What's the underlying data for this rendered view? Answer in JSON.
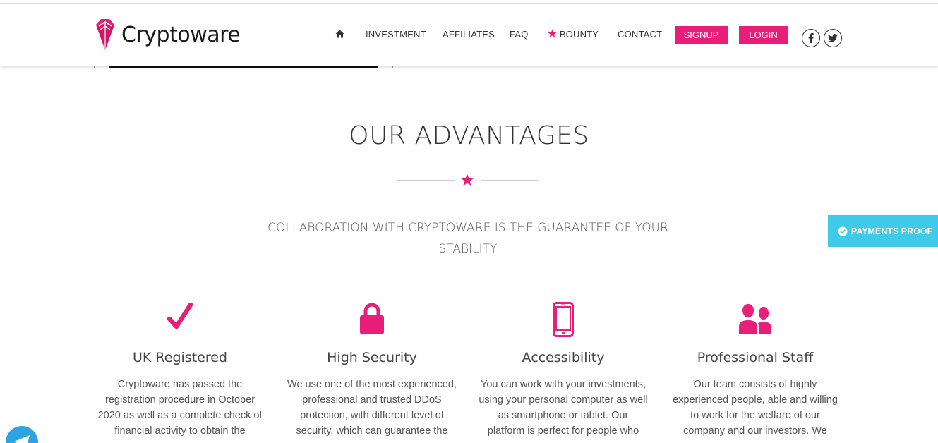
{
  "brand": {
    "name": "Cryptoware"
  },
  "nav": {
    "home_icon": "home-icon",
    "items": [
      {
        "label": "INVESTMENT"
      },
      {
        "label": "AFFILIATES"
      },
      {
        "label": "FAQ"
      },
      {
        "label": "BOUNTY",
        "icon": "star-icon"
      },
      {
        "label": "CONTACT"
      }
    ],
    "signup_label": "SIGNUP",
    "login_label": "LOGIN",
    "social_icons": [
      "facebook-icon",
      "twitter-icon"
    ]
  },
  "advantages": {
    "title": "OUR ADVANTAGES",
    "subtitle_line1": "COLLABORATION WITH CRYPTOWARE IS THE GUARANTEE OF YOUR",
    "subtitle_line2": "STABILITY",
    "features": [
      {
        "icon": "checkmark-icon",
        "title": "UK Registered",
        "desc_lines": [
          "Cryptoware has passed the",
          "registration procedure in October",
          "2020 as well as a complete check of",
          "financial activity to obtain the"
        ]
      },
      {
        "icon": "lock-icon",
        "title": "High Security",
        "desc_lines": [
          "We use one of the most experienced,",
          "professional and trusted DDoS",
          "protection, with different level of",
          "security, which can guarantee the"
        ]
      },
      {
        "icon": "smartphone-icon",
        "title": "Accessibility",
        "desc_lines": [
          "You can work with your investments,",
          "using your personal computer as well",
          "as smartphone or tablet. Our",
          "platform is perfect for people who"
        ]
      },
      {
        "icon": "users-icon",
        "title": "Professional Staff",
        "desc_lines": [
          "Our team consists of highly",
          "experienced people, able and willing",
          "to work for the welfare of our",
          "company and our investors. We"
        ]
      }
    ]
  },
  "payments_proof": {
    "label": "PAYMENTS PROOF",
    "icon": "check-circle-icon"
  },
  "colors": {
    "accent": "#e91e79",
    "payments": "#3fcbe8",
    "telegram": "#2ea3e3"
  }
}
